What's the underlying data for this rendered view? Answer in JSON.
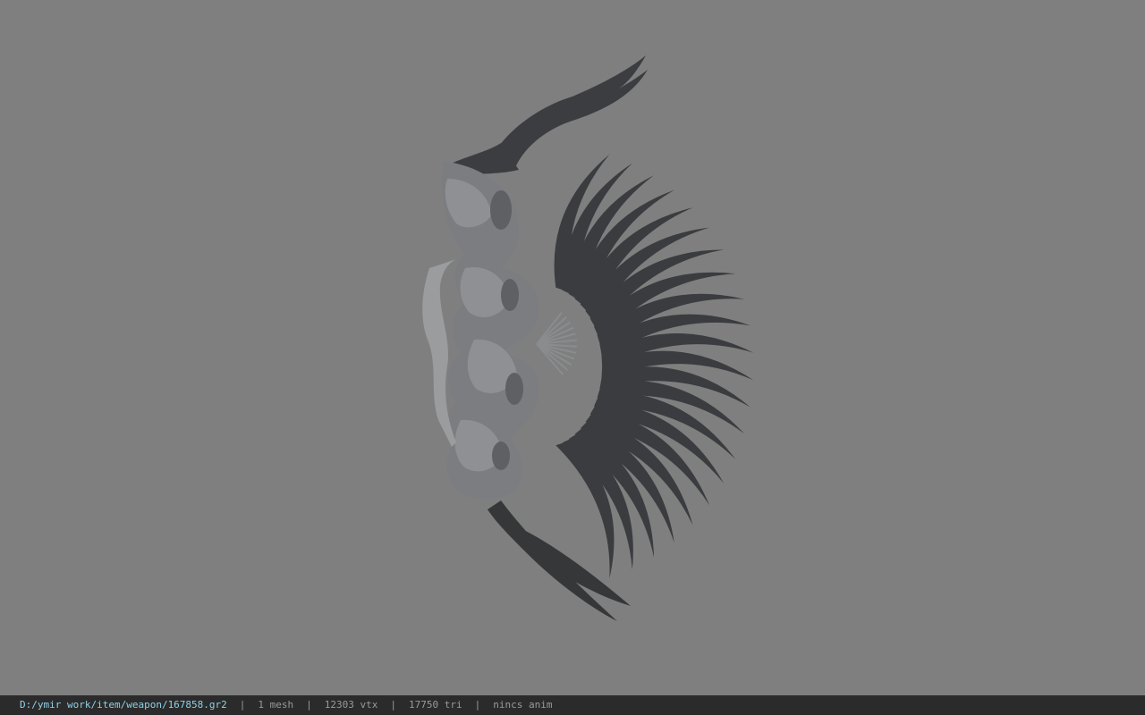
{
  "viewer": {
    "background_color": "#7f7f7f",
    "model_dark_color": "#3a3c3f",
    "model_light_color": "#8a8c8e"
  },
  "statusbar": {
    "file_path": "D:/ymir work/item/weapon/167858.gr2",
    "separator": "|",
    "mesh_count": "1 mesh",
    "vertex_count": "12303 vtx",
    "triangle_count": "17750 tri",
    "anim_status": "nincs anim"
  }
}
